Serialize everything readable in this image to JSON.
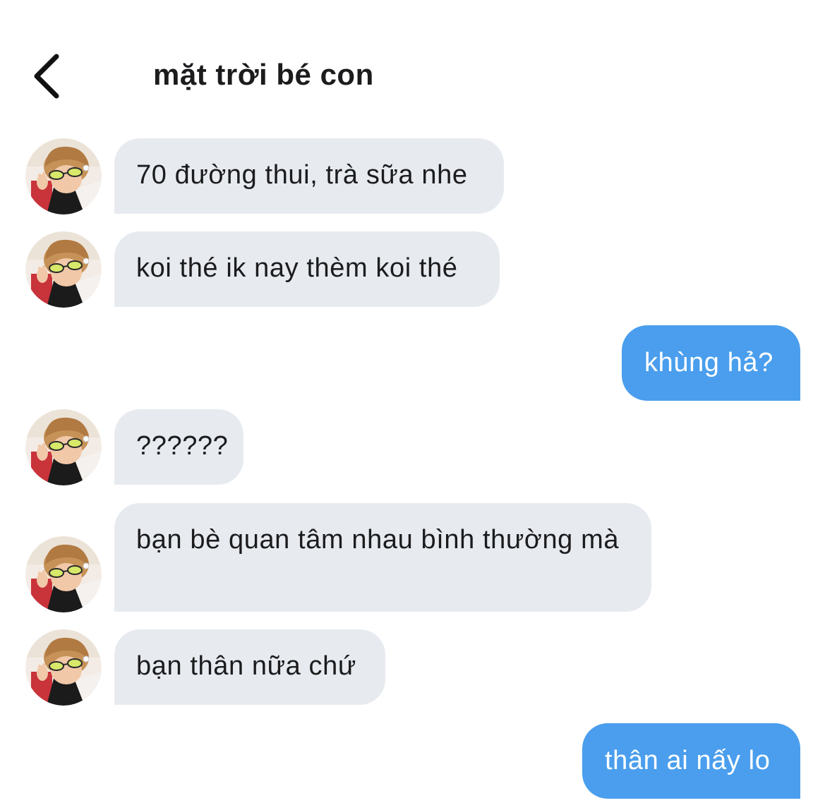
{
  "header": {
    "title": "mặt trời bé con",
    "back_icon": "chevron-left-icon"
  },
  "colors": {
    "incoming_bubble": "#e7ebf0",
    "outgoing_bubble": "#4a9eed",
    "text_dark": "#1c1c1e",
    "text_light": "#ffffff"
  },
  "messages": [
    {
      "direction": "incoming",
      "text": "70 đường thui, trà sữa nhe"
    },
    {
      "direction": "incoming",
      "text": "koi thé ik nay thèm koi thé"
    },
    {
      "direction": "outgoing",
      "text": "khùng hả?"
    },
    {
      "direction": "incoming",
      "text": "??????"
    },
    {
      "direction": "incoming",
      "text": "bạn bè quan tâm nhau bình thường mà"
    },
    {
      "direction": "incoming",
      "text": "bạn thân nữa chứ"
    },
    {
      "direction": "outgoing",
      "text": "thân ai nấy lo"
    }
  ]
}
